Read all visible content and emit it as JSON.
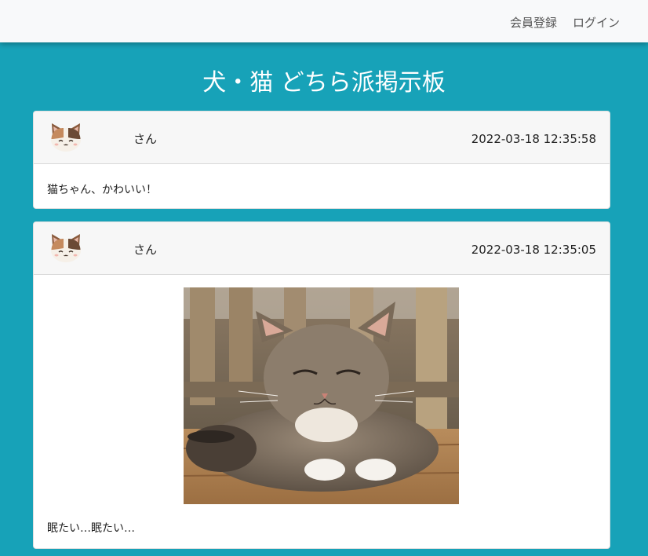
{
  "navbar": {
    "register_label": "会員登録",
    "login_label": "ログイン"
  },
  "page": {
    "title": "犬・猫 どちら派掲示板"
  },
  "posts": [
    {
      "username": "さん",
      "timestamp": "2022-03-18 12:35:58",
      "text": "猫ちゃん、かわいい！",
      "avatar_icon": "calico-cat-avatar-icon"
    },
    {
      "username": "さん",
      "timestamp": "2022-03-18 12:35:05",
      "text": "眠たい…眠たい…",
      "avatar_icon": "calico-cat-avatar-icon",
      "image": "sleeping-tabby-cat-photo"
    }
  ],
  "colors": {
    "background": "#17a2b8",
    "navbar": "#f8f9fa",
    "card_header": "#f7f7f7"
  }
}
